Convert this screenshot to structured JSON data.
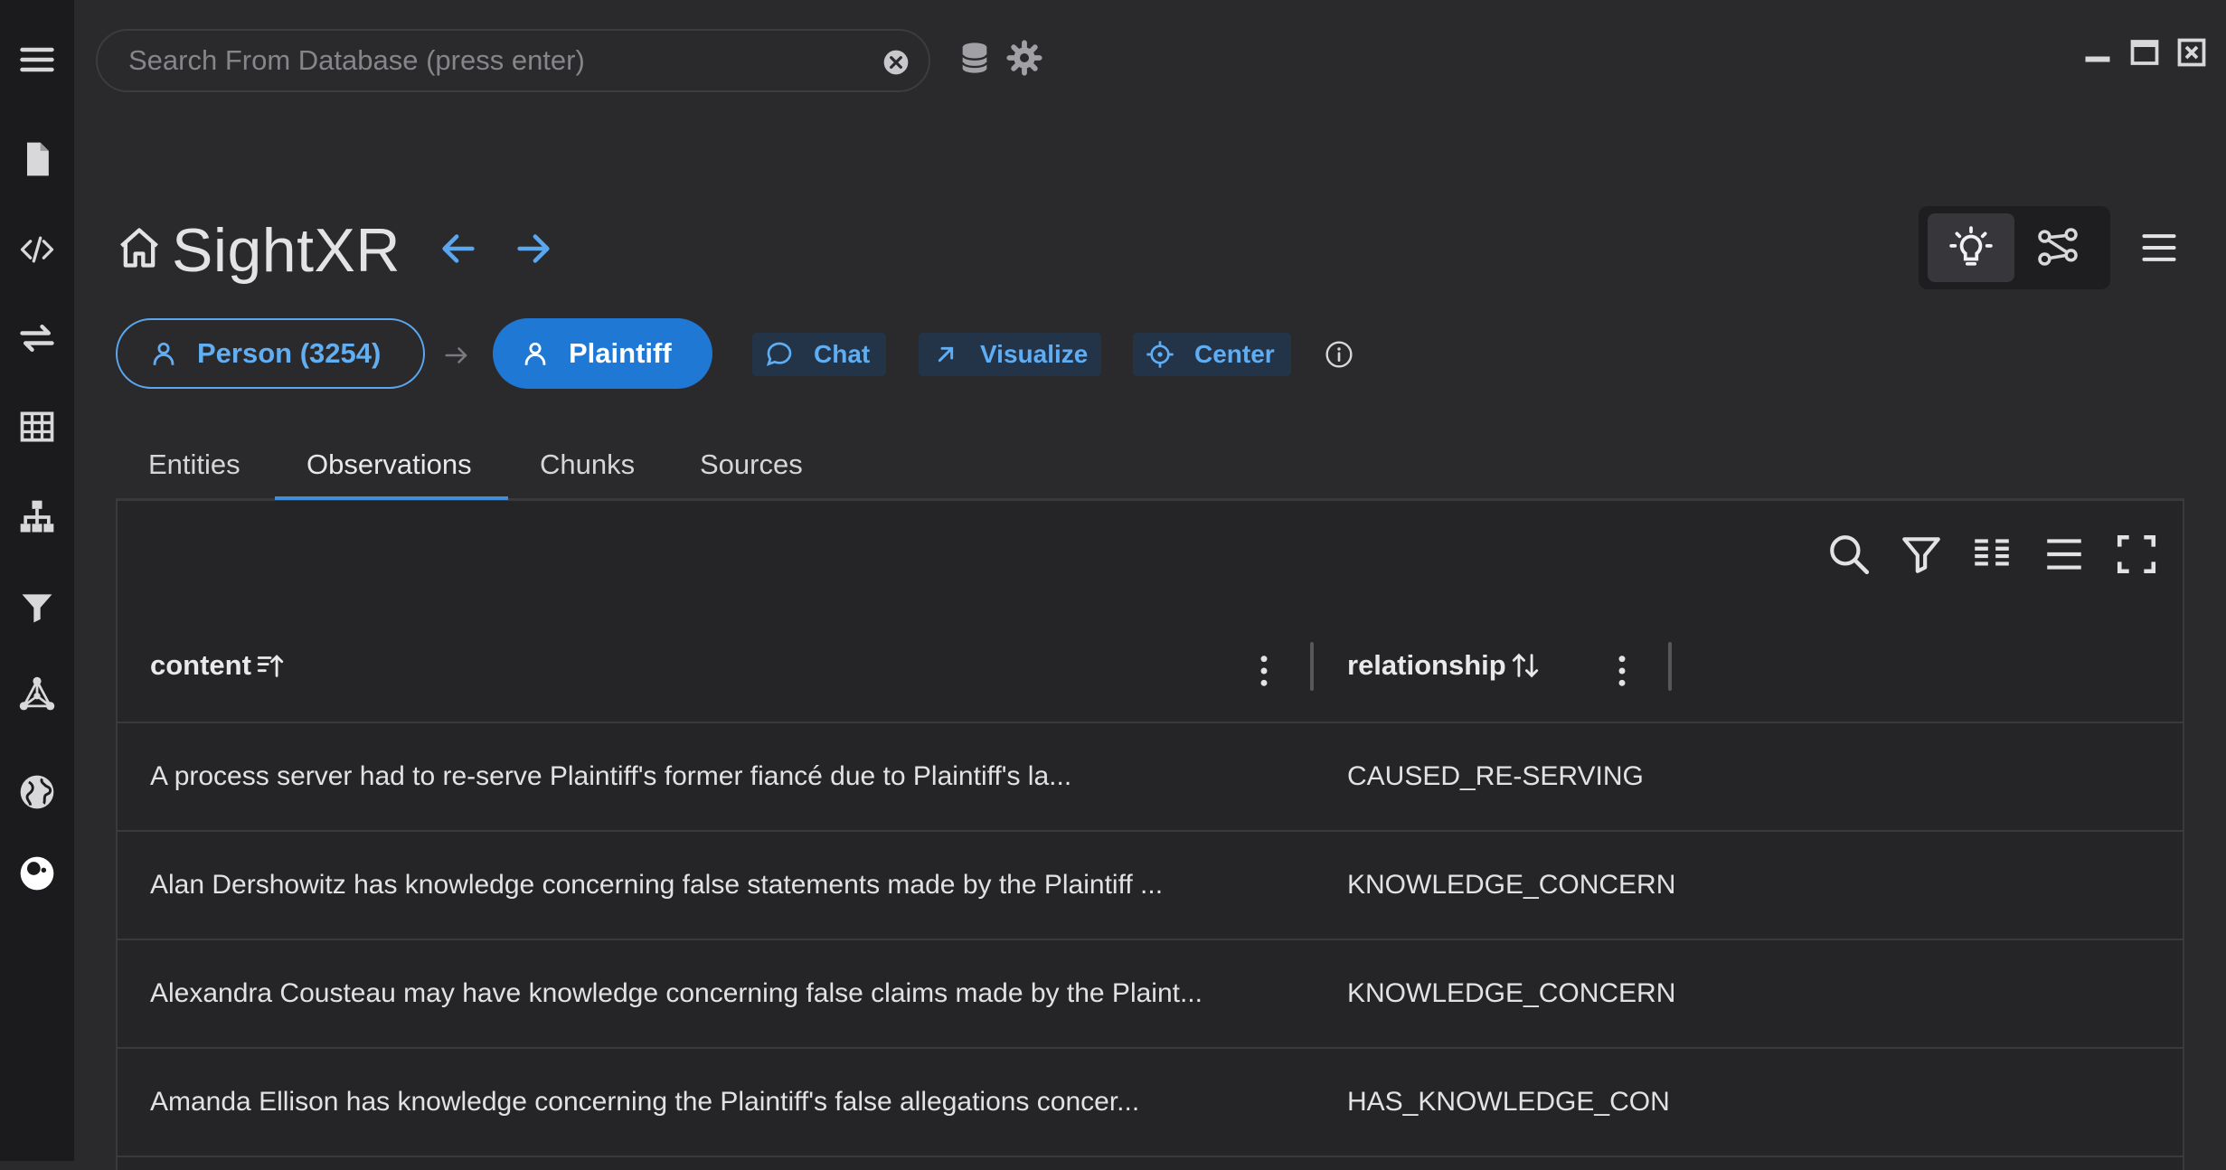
{
  "search": {
    "placeholder": "Search From Database (press enter)"
  },
  "header": {
    "title": "SightXR"
  },
  "breadcrumb": {
    "entity_type": "Person (3254)",
    "entity": "Plaintiff"
  },
  "actions": {
    "chat": "Chat",
    "visualize": "Visualize",
    "center": "Center"
  },
  "tabs": [
    {
      "label": "Entities",
      "active": false
    },
    {
      "label": "Observations",
      "active": true
    },
    {
      "label": "Chunks",
      "active": false
    },
    {
      "label": "Sources",
      "active": false
    }
  ],
  "table": {
    "columns": [
      "content",
      "relationship"
    ],
    "rows": [
      {
        "content": "A process server had to re-serve Plaintiff's former fiancé due to Plaintiff's la...",
        "relationship": "CAUSED_RE-SERVING"
      },
      {
        "content": "Alan Dershowitz has knowledge concerning false statements made by the Plaintiff ...",
        "relationship": "KNOWLEDGE_CONCERN"
      },
      {
        "content": "Alexandra Cousteau may have knowledge concerning false claims made by the Plaint...",
        "relationship": "KNOWLEDGE_CONCERN"
      },
      {
        "content": "Amanda Ellison has knowledge concerning the Plaintiff's false allegations concer...",
        "relationship": "HAS_KNOWLEDGE_CON"
      }
    ]
  },
  "colors": {
    "accent": "#1e78d4",
    "accent_text": "#5fadf2",
    "background": "#2a2a2c",
    "sidebar": "#1b1b1d"
  }
}
